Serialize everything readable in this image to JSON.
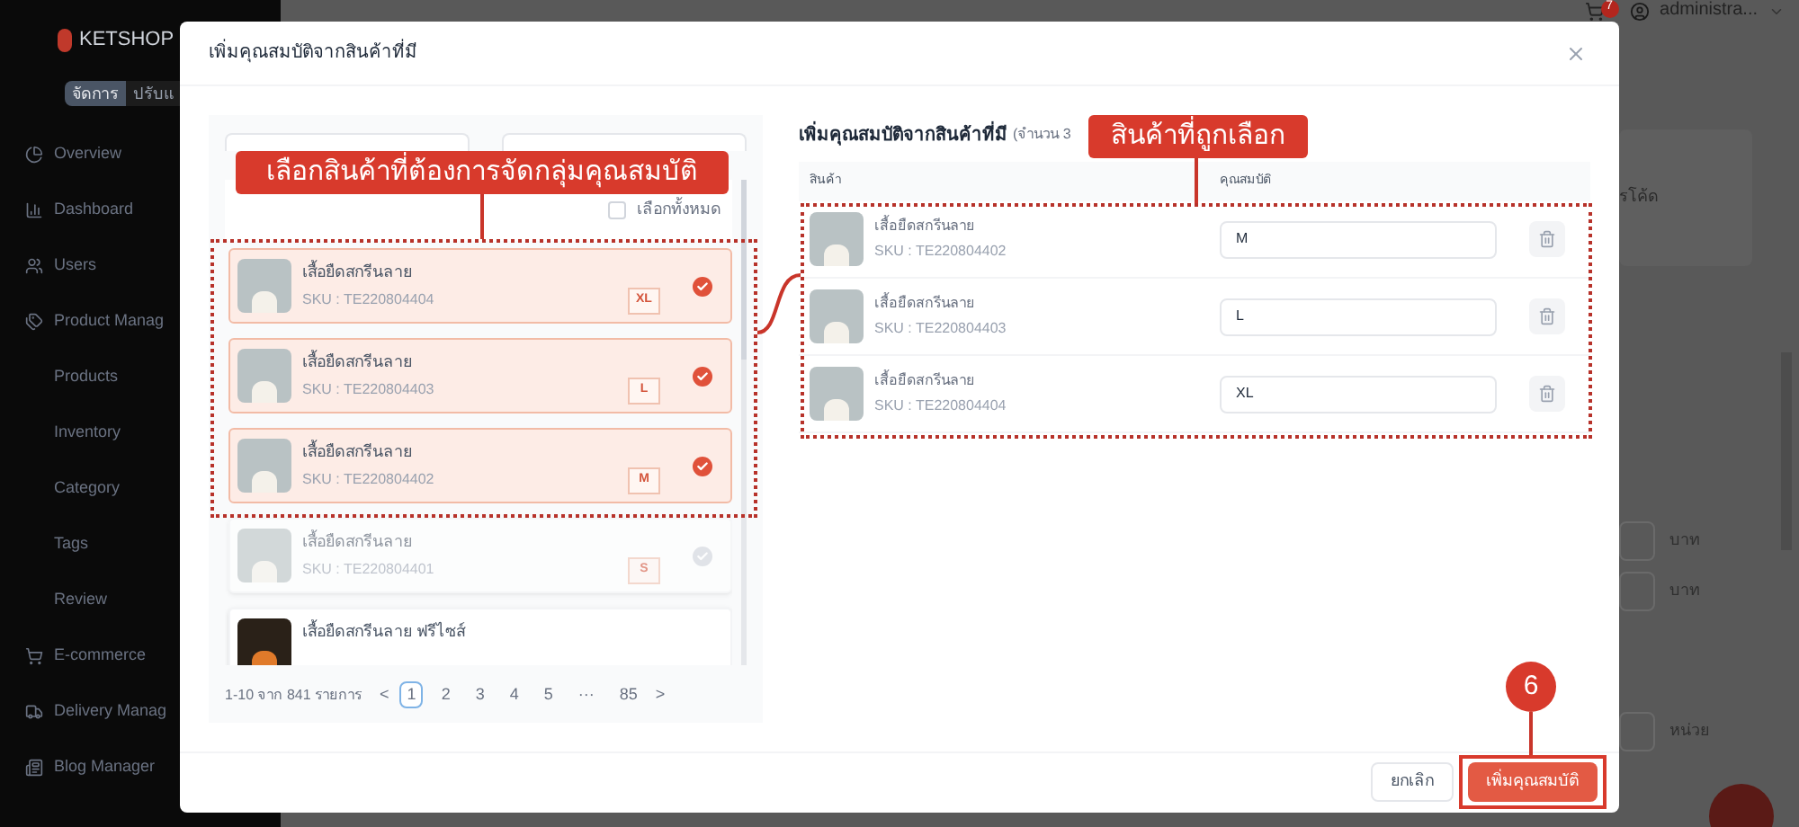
{
  "sidebar": {
    "logo": "KETSHOP",
    "mode_tabs": [
      {
        "label": "จัดการ",
        "selected": true
      },
      {
        "label": "ปรับแ",
        "selected": false
      }
    ],
    "items": [
      {
        "label": "Overview",
        "kind": "overview"
      },
      {
        "label": "Dashboard",
        "kind": "dashboard"
      },
      {
        "label": "Users",
        "kind": "users"
      },
      {
        "label": "Product Manag",
        "kind": "products",
        "children": [
          {
            "label": "Products"
          },
          {
            "label": "Inventory"
          },
          {
            "label": "Category"
          },
          {
            "label": "Tags"
          },
          {
            "label": "Review"
          }
        ]
      },
      {
        "label": "E-commerce",
        "kind": "cart"
      },
      {
        "label": "Delivery Manag",
        "kind": "truck"
      },
      {
        "label": "Blog Manager",
        "kind": "blog"
      }
    ]
  },
  "header": {
    "cart_count": "7",
    "user": "administra..."
  },
  "page_behind": {
    "note": "รโค้ด",
    "units": [
      "บาท",
      "บาท",
      "หน่วย"
    ]
  },
  "modal": {
    "title": "เพิ่มคุณสมบัติจากสินค้าที่มี",
    "picker": {
      "select_all": {
        "label": "เลือกทั้งหมด",
        "checked": false
      },
      "items": [
        {
          "name": "เสื้อยืดสกรีนลาย",
          "sku": "SKU : TE220804404",
          "size": "XL",
          "selected": true,
          "disabled": false,
          "kind": "light"
        },
        {
          "name": "เสื้อยืดสกรีนลาย",
          "sku": "SKU : TE220804403",
          "size": "L",
          "selected": true,
          "disabled": false,
          "kind": "light"
        },
        {
          "name": "เสื้อยืดสกรีนลาย",
          "sku": "SKU : TE220804402",
          "size": "M",
          "selected": true,
          "disabled": false,
          "kind": "light"
        },
        {
          "name": "เสื้อยืดสกรีนลาย",
          "sku": "SKU : TE220804401",
          "size": "S",
          "selected": false,
          "disabled": true,
          "kind": "light"
        },
        {
          "name": "เสื้อยืดสกรีนลาย ฟรีไซส์",
          "selected": false,
          "disabled": false,
          "kind": "dark"
        }
      ],
      "pagination": {
        "summary": "1-10 จาก 841 รายการ",
        "prev": "<",
        "next": ">",
        "pages": [
          {
            "label": "1",
            "selected": true
          },
          {
            "label": "2",
            "selected": false
          },
          {
            "label": "3",
            "selected": false
          },
          {
            "label": "4",
            "selected": false
          },
          {
            "label": "5",
            "selected": false
          },
          {
            "label": "···",
            "selected": false
          },
          {
            "label": "85",
            "selected": false
          }
        ]
      }
    },
    "selected": {
      "title": "เพิ่มคุณสมบัติจากสินค้าที่มี",
      "count_note": "(จำนวน 3",
      "columns": [
        "สินค้า",
        "คุณสมบัติ"
      ],
      "rows": [
        {
          "name": "เสื้อยืดสกรีนลาย",
          "sku": "SKU : TE220804402",
          "value": "M"
        },
        {
          "name": "เสื้อยืดสกรีนลาย",
          "sku": "SKU : TE220804403",
          "value": "L"
        },
        {
          "name": "เสื้อยืดสกรีนลาย",
          "sku": "SKU : TE220804404",
          "value": "XL"
        }
      ]
    },
    "buttons": [
      {
        "label": "ยกเลิก",
        "kind": "secondary"
      },
      {
        "label": "เพิ่มคุณสมบัติ",
        "kind": "primary"
      }
    ]
  },
  "annotations": {
    "picker_label": "เลือกสินค้าที่ต้องการจัดกลุ่มคุณสมบัติ",
    "selected_label": "สินค้าที่ถูกเลือก",
    "step": "6"
  }
}
